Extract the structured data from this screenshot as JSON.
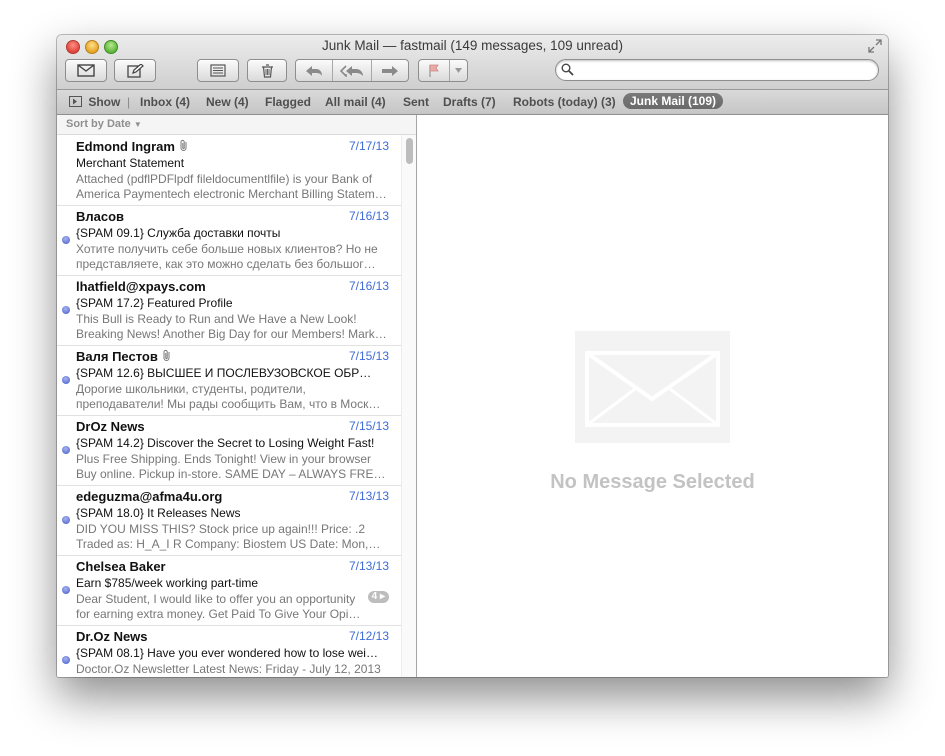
{
  "window": {
    "title": "Junk Mail — fastmail (149 messages, 109 unread)"
  },
  "search": {
    "placeholder": "",
    "value": ""
  },
  "favorites": {
    "show_label": "Show",
    "mailboxes": [
      "Inbox (4)",
      "New (4)",
      "Flagged",
      "All mail (4)",
      "Sent",
      "Drafts (7)",
      "Robots (today) (3)"
    ],
    "active_mailbox": "Junk Mail (109)"
  },
  "sort": {
    "label": "Sort by Date"
  },
  "messages": [
    {
      "sender": "Edmond Ingram",
      "date": "7/17/13",
      "subject": "Merchant Statement",
      "preview1": "Attached (pdflPDFlpdf fileldocumentlfile) is your Bank of",
      "preview2": "America Paymentech electronic Merchant Billing Statem…"
    },
    {
      "sender": "Власов",
      "date": "7/16/13",
      "subject": "{SPAM 09.1}   Служба доставки почты",
      "preview1": "Хотите получить себе больше новых клиентов? Но не",
      "preview2": "представляете, как это можно сделать без большог…"
    },
    {
      "sender": "lhatfield@xpays.com",
      "date": "7/16/13",
      "subject": "{SPAM 17.2} Featured Profile",
      "preview1": "This Bull is Ready to Run and We Have a New Look!",
      "preview2": "Breaking News! Another Big Day for our Members! Mark…"
    },
    {
      "sender": "Валя Пестов",
      "date": "7/15/13",
      "subject": "{SPAM 12.6} ВЫСШЕЕ И ПОСЛЕВУЗОВСКОЕ ОБР…",
      "preview1": "Дорогие школьники, студенты, родители,",
      "preview2": "преподаватели! Мы рады сообщить Вам, что в Моск…"
    },
    {
      "sender": "DrOz News",
      "date": "7/15/13",
      "subject": "{SPAM 14.2} Discover the Secret to Losing Weight Fast!",
      "preview1": "Plus Free Shipping. Ends Tonight! View in your browser",
      "preview2": "Buy online. Pickup in-store. SAME DAY – ALWAYS FRE…"
    },
    {
      "sender": "edeguzma@afma4u.org",
      "date": "7/13/13",
      "subject": "{SPAM 18.0} It Releases News",
      "preview1": "DID YOU MISS THIS? Stock price up again!!! Price: .2",
      "preview2": "Traded as: H_A_I R Company: Biostem US Date: Mon,…"
    },
    {
      "sender": "Chelsea Baker",
      "date": "7/13/13",
      "subject": "Earn $785/week working part-time",
      "preview1": "Dear Student, I would like to offer you an opportunity",
      "preview2": "for earning extra money. Get Paid To Give Your Opi…",
      "thread_count": "4 ▸"
    },
    {
      "sender": "Dr.Oz News",
      "date": "7/12/13",
      "subject": "{SPAM 08.1} Have you ever wondered how to lose wei…",
      "preview1": "Doctor.Oz Newsletter Latest News: Friday - July 12, 2013",
      "preview2": ""
    }
  ],
  "viewer": {
    "empty_text": "No Message Selected"
  },
  "colors": {
    "date_blue": "#3e6bd6",
    "unread_dot": "#5a6fd2",
    "active_mailbox_bg": "#6f6f6f"
  },
  "icons": {
    "get-mail": "envelope-icon",
    "compose": "compose-icon",
    "archive": "archive-icon",
    "delete": "trash-icon",
    "reply": "reply-icon",
    "reply-all": "reply-all-icon",
    "forward": "forward-icon",
    "flag": "flag-icon",
    "search": "magnifier-icon"
  }
}
